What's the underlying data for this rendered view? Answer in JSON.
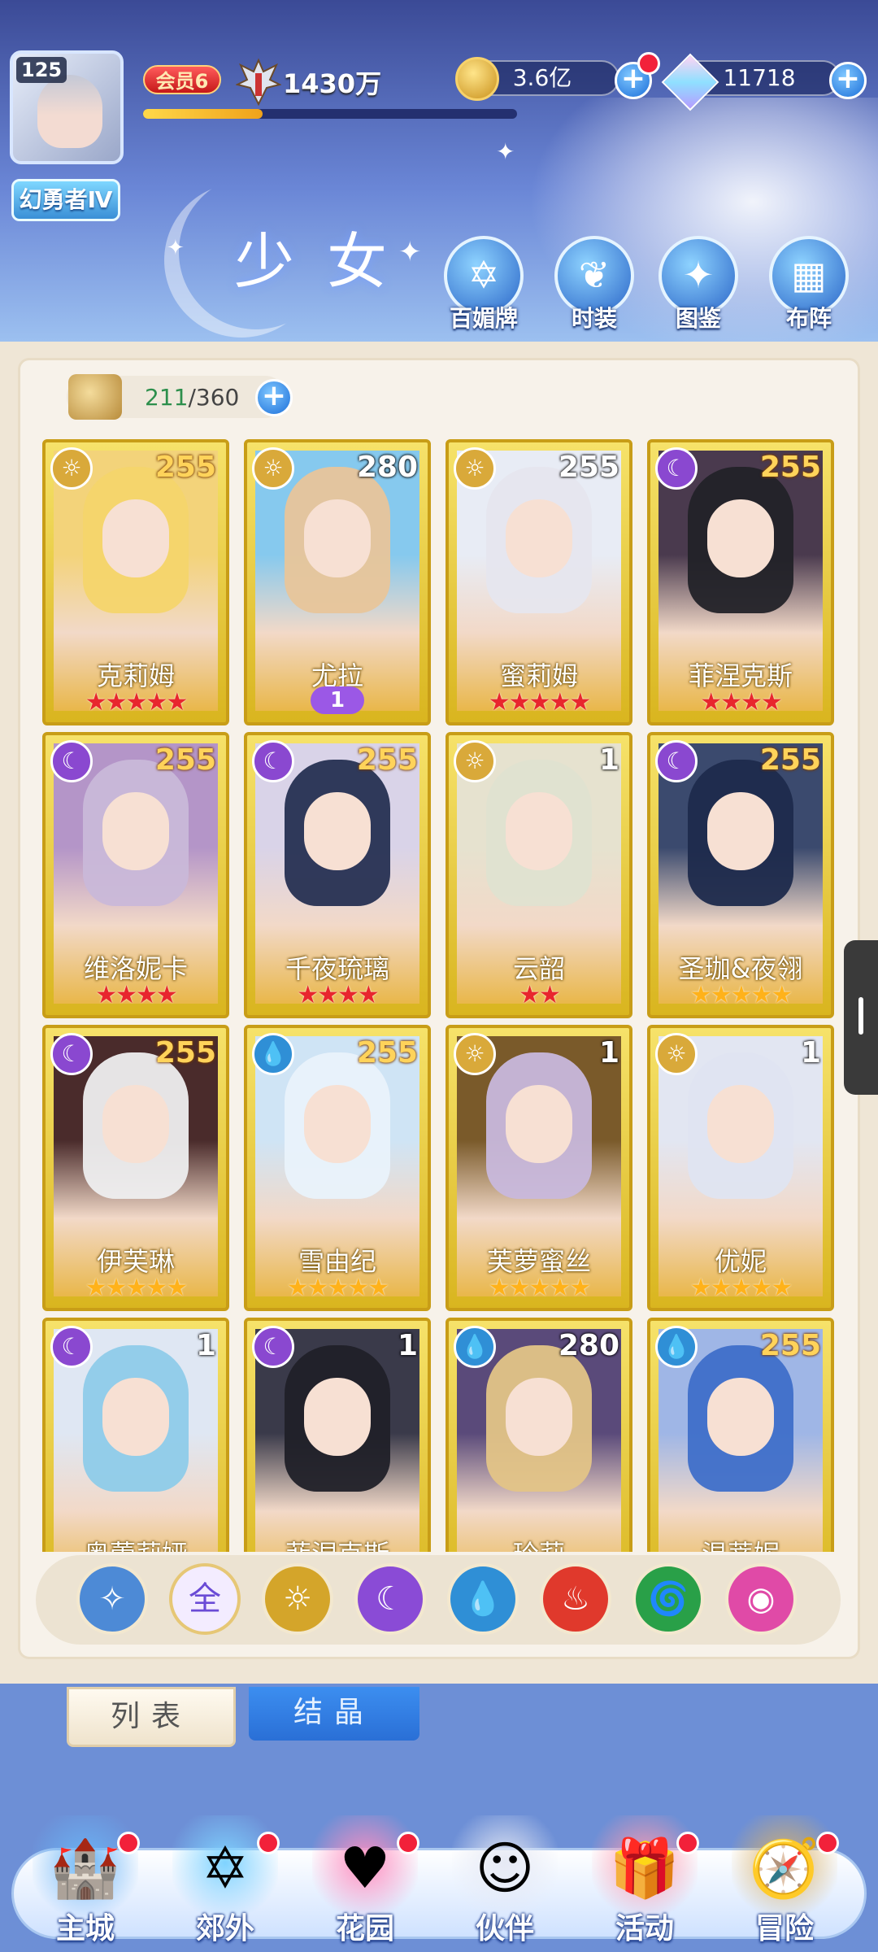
{
  "player": {
    "level": "125",
    "title": "幻勇者Ⅳ",
    "vip": "会员6",
    "power": "1430万",
    "exp_fraction": 0.32
  },
  "resources": {
    "gold": "3.6亿",
    "gems": "11718"
  },
  "page": {
    "heading": "少女"
  },
  "menu": [
    {
      "label": "百媚牌",
      "icon": "card-hexagram-icon"
    },
    {
      "label": "时装",
      "icon": "outfit-icon"
    },
    {
      "label": "图鉴",
      "icon": "book-icon"
    },
    {
      "label": "布阵",
      "icon": "grid-formation-icon"
    }
  ],
  "capacity": {
    "current": "211",
    "separator": "/",
    "max": "360"
  },
  "characters": [
    {
      "name": "克莉姆",
      "level": "255",
      "element": "light",
      "stars": 5,
      "star_color": "red",
      "level_color": "gold",
      "bg": "#f3d37a",
      "hair": "#f4d56b"
    },
    {
      "name": "尤拉",
      "level": "280",
      "element": "light",
      "stars": 0,
      "star_color": "red",
      "level_color": "white",
      "badge": "1",
      "bg": "#86c9ee",
      "hair": "#e8c59a"
    },
    {
      "name": "蜜莉姆",
      "level": "255",
      "element": "light",
      "stars": 5,
      "star_color": "red",
      "level_color": "white",
      "bg": "#e8ecf5",
      "hair": "#e6e6ee"
    },
    {
      "name": "菲涅克斯",
      "level": "255",
      "element": "moon",
      "stars": 4,
      "star_color": "red",
      "level_color": "gold",
      "bg": "#4a3a4e",
      "hair": "#222228"
    },
    {
      "name": "维洛妮卡",
      "level": "255",
      "element": "moon",
      "stars": 4,
      "star_color": "red",
      "level_color": "gold",
      "bg": "#b495c8",
      "hair": "#c9b8d9"
    },
    {
      "name": "千夜琉璃",
      "level": "255",
      "element": "moon",
      "stars": 4,
      "star_color": "red",
      "level_color": "gold",
      "bg": "#d9d3e8",
      "hair": "#263052"
    },
    {
      "name": "云韶",
      "level": "1",
      "element": "light",
      "stars": 2,
      "star_color": "red",
      "level_color": "white",
      "bg": "#e6e2cf",
      "hair": "#dfe2d0"
    },
    {
      "name": "圣珈&夜翎",
      "level": "255",
      "element": "moon",
      "stars": 5,
      "star_color": "gold",
      "level_color": "gold",
      "bg": "#3b4a6e",
      "hair": "#1d2a4c"
    },
    {
      "name": "伊芙琳",
      "level": "255",
      "element": "moon",
      "stars": 5,
      "star_color": "gold",
      "level_color": "gold",
      "bg": "#4a2b2b",
      "hair": "#eeeeef"
    },
    {
      "name": "雪由纪",
      "level": "255",
      "element": "water",
      "stars": 5,
      "star_color": "gold",
      "level_color": "gold",
      "bg": "#cfe4f5",
      "hair": "#e9f2fb"
    },
    {
      "name": "芙萝蜜丝",
      "level": "1",
      "element": "light",
      "stars": 5,
      "star_color": "gold",
      "level_color": "white",
      "bg": "#7a5a2a",
      "hair": "#c8b8dc"
    },
    {
      "name": "优妮",
      "level": "1",
      "element": "light",
      "stars": 5,
      "star_color": "gold",
      "level_color": "white",
      "bg": "#e2e6f2",
      "hair": "#dfe4f1"
    },
    {
      "name": "奥蕾莉娅",
      "level": "1",
      "element": "moon",
      "stars": 0,
      "star_color": "gold",
      "level_color": "white",
      "bg": "#dfe7f3",
      "hair": "#8ecbe9"
    },
    {
      "name": "菲涅克斯",
      "level": "1",
      "element": "moon",
      "stars": 0,
      "star_color": "gold",
      "level_color": "white",
      "bg": "#3a3a4a",
      "hair": "#202028"
    },
    {
      "name": "玲莉",
      "level": "280",
      "element": "water",
      "stars": 0,
      "star_color": "gold",
      "level_color": "white",
      "bg": "#5a4a7a",
      "hair": "#e3c487"
    },
    {
      "name": "温蒂妮",
      "level": "255",
      "element": "water",
      "stars": 0,
      "star_color": "gold",
      "level_color": "gold",
      "bg": "#9fb6e6",
      "hair": "#3f6fc9"
    }
  ],
  "filters": [
    {
      "id": "toggle",
      "label": "",
      "color": "#4d8ad6"
    },
    {
      "id": "all",
      "label": "全",
      "color": "#f3ecff"
    },
    {
      "id": "light",
      "label": "",
      "color": "#d4a52a"
    },
    {
      "id": "moon",
      "label": "",
      "color": "#8a4bd6"
    },
    {
      "id": "water",
      "label": "",
      "color": "#2f8fd6"
    },
    {
      "id": "fire",
      "label": "",
      "color": "#e0392c"
    },
    {
      "id": "wind",
      "label": "",
      "color": "#29a048"
    },
    {
      "id": "dark",
      "label": "",
      "color": "#e04aa7"
    }
  ],
  "tabs": {
    "list": "列表",
    "crystal": "结晶"
  },
  "bottom_nav": [
    {
      "label": "主城",
      "icon": "castle-icon",
      "dot": true
    },
    {
      "label": "郊外",
      "icon": "magic-circle-icon",
      "dot": true
    },
    {
      "label": "花园",
      "icon": "heart-icon",
      "dot": true
    },
    {
      "label": "伙伴",
      "icon": "partner-portrait-icon",
      "dot": false
    },
    {
      "label": "活动",
      "icon": "gift-icon",
      "dot": true
    },
    {
      "label": "冒险",
      "icon": "compass-icon",
      "dot": true
    }
  ]
}
